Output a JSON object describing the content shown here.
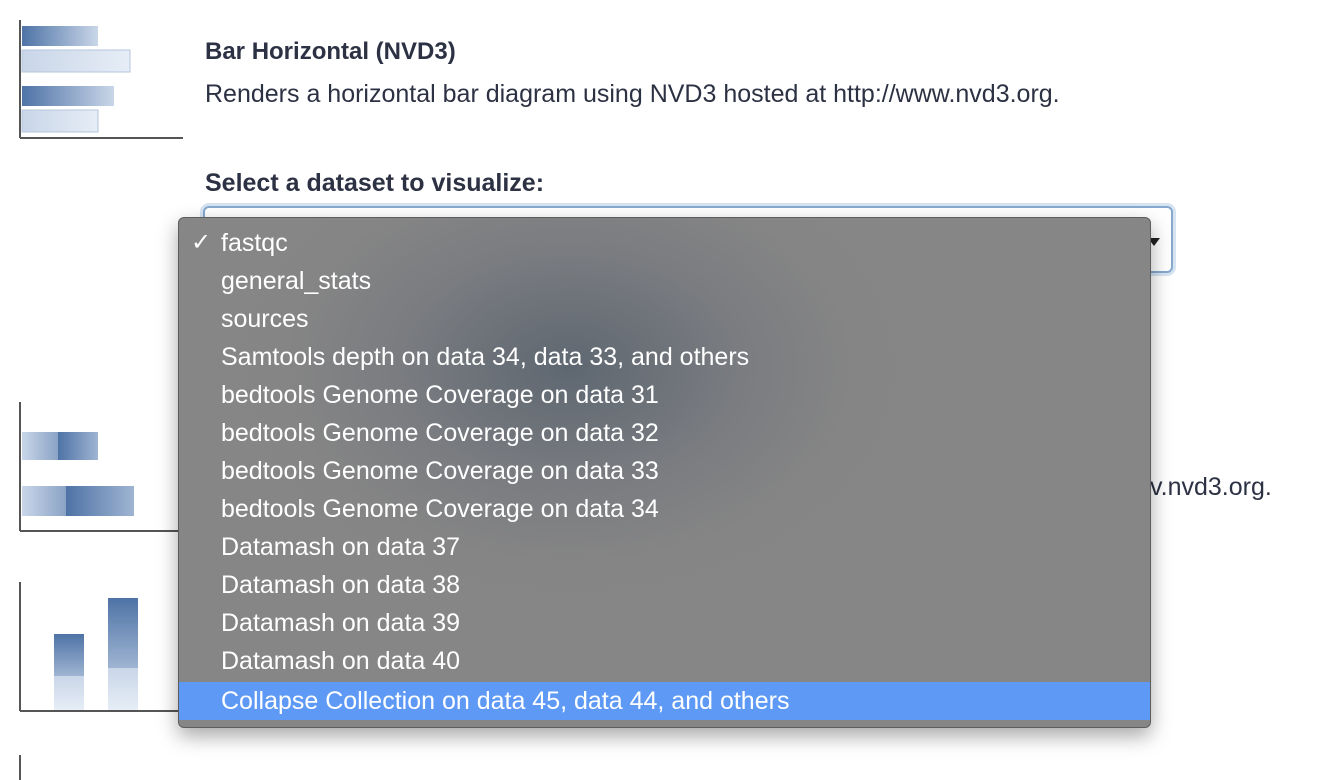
{
  "plugin": {
    "title": "Bar Horizontal (NVD3)",
    "description": "Renders a horizontal bar diagram using NVD3 hosted at http://www.nvd3.org.",
    "second_description_tail": "v.nvd3.org."
  },
  "select": {
    "label": "Select a dataset to visualize:",
    "checkmark": "✓",
    "current_value": "fastqc",
    "highlighted_value": "Collapse Collection on data 45, data 44, and others",
    "options": [
      "fastqc",
      "general_stats",
      "sources",
      "Samtools depth on data 34, data 33, and others",
      "bedtools Genome Coverage on data 31",
      "bedtools Genome Coverage on data 32",
      "bedtools Genome Coverage on data 33",
      "bedtools Genome Coverage on data 34",
      "Datamash on data 37",
      "Datamash on data 38",
      "Datamash on data 39",
      "Datamash on data 40",
      "Collapse Collection on data 45, data 44, and others"
    ]
  },
  "colors": {
    "highlight": "#5e9af5",
    "menu_bg": "#858585",
    "focus_border": "#86a9cf",
    "text": "#2c3143"
  }
}
